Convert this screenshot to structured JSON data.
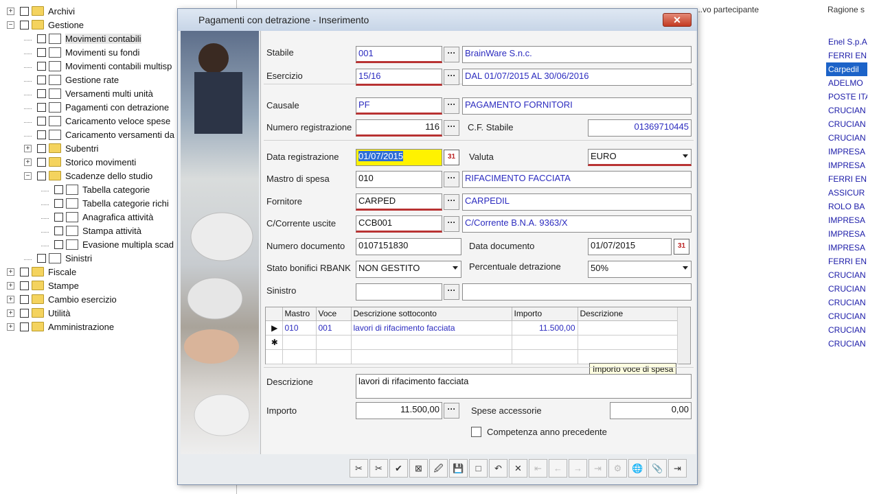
{
  "tree": [
    {
      "label": "Archivi",
      "level": 0,
      "exp": "+",
      "icon": "folder"
    },
    {
      "label": "Gestione",
      "level": 0,
      "exp": "−",
      "icon": "folder"
    },
    {
      "label": "Movimenti contabili",
      "level": 1,
      "icon": "doc",
      "selected": true
    },
    {
      "label": "Movimenti su fondi",
      "level": 1,
      "icon": "doc"
    },
    {
      "label": "Movimenti contabili multisp",
      "level": 1,
      "icon": "doc"
    },
    {
      "label": "Gestione rate",
      "level": 1,
      "icon": "doc"
    },
    {
      "label": "Versamenti multi unità",
      "level": 1,
      "icon": "doc"
    },
    {
      "label": "Pagamenti con detrazione",
      "level": 1,
      "icon": "doc"
    },
    {
      "label": "Caricamento veloce spese",
      "level": 1,
      "icon": "doc"
    },
    {
      "label": "Caricamento versamenti da",
      "level": 1,
      "icon": "doc"
    },
    {
      "label": "Subentri",
      "level": 1,
      "exp": "+",
      "icon": "folder"
    },
    {
      "label": "Storico movimenti",
      "level": 1,
      "exp": "+",
      "icon": "folder"
    },
    {
      "label": "Scadenze dello studio",
      "level": 1,
      "exp": "−",
      "icon": "folder"
    },
    {
      "label": "Tabella categorie",
      "level": 2,
      "icon": "doc"
    },
    {
      "label": "Tabella categorie richi",
      "level": 2,
      "icon": "doc"
    },
    {
      "label": "Anagrafica attività",
      "level": 2,
      "icon": "doc"
    },
    {
      "label": "Stampa attività",
      "level": 2,
      "icon": "doc"
    },
    {
      "label": "Evasione multipla scad",
      "level": 2,
      "icon": "doc"
    },
    {
      "label": "Sinistri",
      "level": 1,
      "icon": "doc"
    },
    {
      "label": "Fiscale",
      "level": 0,
      "exp": "+",
      "icon": "folder"
    },
    {
      "label": "Stampe",
      "level": 0,
      "exp": "+",
      "icon": "folder"
    },
    {
      "label": "Cambio esercizio",
      "level": 0,
      "exp": "+",
      "icon": "folder"
    },
    {
      "label": "Utilità",
      "level": 0,
      "exp": "+",
      "icon": "folder"
    },
    {
      "label": "Amministrazione",
      "level": 0,
      "exp": "+",
      "icon": "folder"
    }
  ],
  "background_list": {
    "header_partial": "...vo partecipante",
    "header_ragione": "Ragione s",
    "rows": [
      "Enel S.p.A",
      "FERRI ENI",
      "Carpedil",
      "ADELMO",
      "POSTE ITA",
      "CRUCIAN",
      "CRUCIAN",
      "CRUCIAN",
      "IMPRESA",
      "IMPRESA",
      "FERRI ENI",
      "ASSICUR",
      "ROLO BA",
      "IMPRESA",
      "IMPRESA",
      "IMPRESA",
      "FERRI ENI",
      "CRUCIAN",
      "CRUCIAN",
      "CRUCIAN",
      "CRUCIAN",
      "CRUCIAN",
      "CRUCIAN"
    ],
    "highlight_index": 2
  },
  "dialog": {
    "title": "Pagamenti con detrazione - Inserimento",
    "close": "✕",
    "stabile": {
      "label": "Stabile",
      "code": "001",
      "desc": "BrainWare S.n.c."
    },
    "esercizio": {
      "label": "Esercizio",
      "code": "15/16",
      "desc": "DAL 01/07/2015 AL 30/06/2016"
    },
    "causale": {
      "label": "Causale",
      "code": "PF",
      "desc": "PAGAMENTO FORNITORI"
    },
    "numero_registrazione": {
      "label": "Numero registrazione",
      "value": "116"
    },
    "cf_stabile": {
      "label": "C.F. Stabile",
      "value": "01369710445"
    },
    "data_registrazione": {
      "label": "Data registrazione",
      "value": "01/07/2015"
    },
    "valuta": {
      "label": "Valuta",
      "value": "EURO"
    },
    "mastro_spesa": {
      "label": "Mastro di spesa",
      "code": "010",
      "desc": "RIFACIMENTO FACCIATA"
    },
    "fornitore": {
      "label": "Fornitore",
      "code": "CARPED",
      "desc": "CARPEDIL"
    },
    "cc_uscite": {
      "label": "C/Corrente uscite",
      "code": "CCB001",
      "desc": "C/Corrente B.N.A. 9363/X"
    },
    "numero_documento": {
      "label": "Numero documento",
      "value": "0107151830"
    },
    "data_documento": {
      "label": "Data documento",
      "value": "01/07/2015"
    },
    "stato_bonifici": {
      "label": "Stato bonifici RBANK",
      "value": "NON GESTITO"
    },
    "percentuale": {
      "label": "Percentuale detrazione",
      "value": "50%"
    },
    "sinistro": {
      "label": "Sinistro",
      "code": "",
      "desc": ""
    },
    "grid": {
      "headers": [
        "Mastro",
        "Voce",
        "Descrizione sottoconto",
        "Importo",
        "Descrizione"
      ],
      "rows": [
        [
          "010",
          "001",
          "lavori di rifacimento facciata",
          "11.500,00",
          ""
        ]
      ],
      "new_row_marker": "✱",
      "current_row_marker": "▶",
      "tooltip": "Importo voce di spesa"
    },
    "descrizione": {
      "label": "Descrizione",
      "value": "lavori di rifacimento facciata"
    },
    "importo": {
      "label": "Importo",
      "value": "11.500,00"
    },
    "spese_accessorie": {
      "label": "Spese accessorie",
      "value": "0,00"
    },
    "competenza": {
      "label": "Competenza anno precedente",
      "checked": false
    },
    "dots": "···",
    "cal_icon": "31",
    "toolbar": [
      "✂",
      "✂",
      "✔",
      "⊠",
      "🖉",
      "💾",
      "□",
      "↶",
      "✕",
      "⇤",
      "←",
      "→",
      "⇥",
      "⚙",
      "🌐",
      "📎",
      "⇥"
    ]
  }
}
